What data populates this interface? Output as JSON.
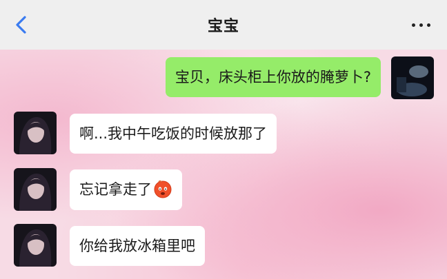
{
  "header": {
    "title": "宝宝",
    "back_icon": "chevron-left-icon",
    "more_icon": "more-icon"
  },
  "messages": [
    {
      "side": "right",
      "text": "宝贝，床头柜上你放的腌萝卜?"
    },
    {
      "side": "left",
      "text": "啊...我中午吃饭的时候放那了"
    },
    {
      "side": "left",
      "text": "忘记拿走了",
      "emoji": "hot-face-emoji"
    },
    {
      "side": "left",
      "text": "你给我放冰箱里吧"
    }
  ],
  "colors": {
    "header_bg": "#efefef",
    "sent_bubble": "#95ec69",
    "received_bubble": "#ffffff",
    "back_icon": "#3a7bf0",
    "chat_bg": "#f7dbe5"
  }
}
